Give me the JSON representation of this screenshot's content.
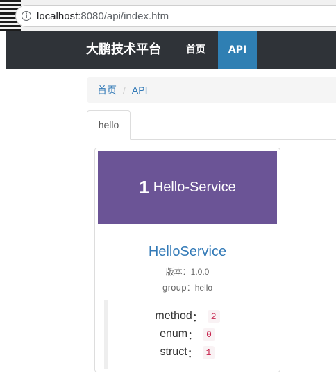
{
  "browser": {
    "url_host": "localhost",
    "url_rest": ":8080/api/index.htm"
  },
  "navbar": {
    "brand": "大鹏技术平台",
    "items": [
      {
        "label": "首页",
        "active": false
      },
      {
        "label": "API",
        "active": true
      }
    ]
  },
  "breadcrumb": {
    "home": "首页",
    "separator": "/",
    "current": "API"
  },
  "tabs": [
    {
      "label": "hello",
      "active": true
    }
  ],
  "service_card": {
    "number": "1",
    "title": "Hello-Service",
    "name": "HelloService",
    "version_label": "版本：",
    "version": "1.0.0",
    "group_label": "group：",
    "group": "hello",
    "stats": [
      {
        "label": "method",
        "sep": "：",
        "value": "2"
      },
      {
        "label": "enum",
        "sep": "：",
        "value": "0"
      },
      {
        "label": "struct",
        "sep": "：",
        "value": "1"
      }
    ]
  },
  "colors": {
    "navbar_bg": "#2f3338",
    "nav_active_bg": "#2f7fb3",
    "card_header_bg": "#6b5496",
    "link": "#337ab7",
    "code_text": "#c7254e",
    "code_bg": "#f9f2f4"
  },
  "icons": {
    "address_bar": "info-icon"
  }
}
